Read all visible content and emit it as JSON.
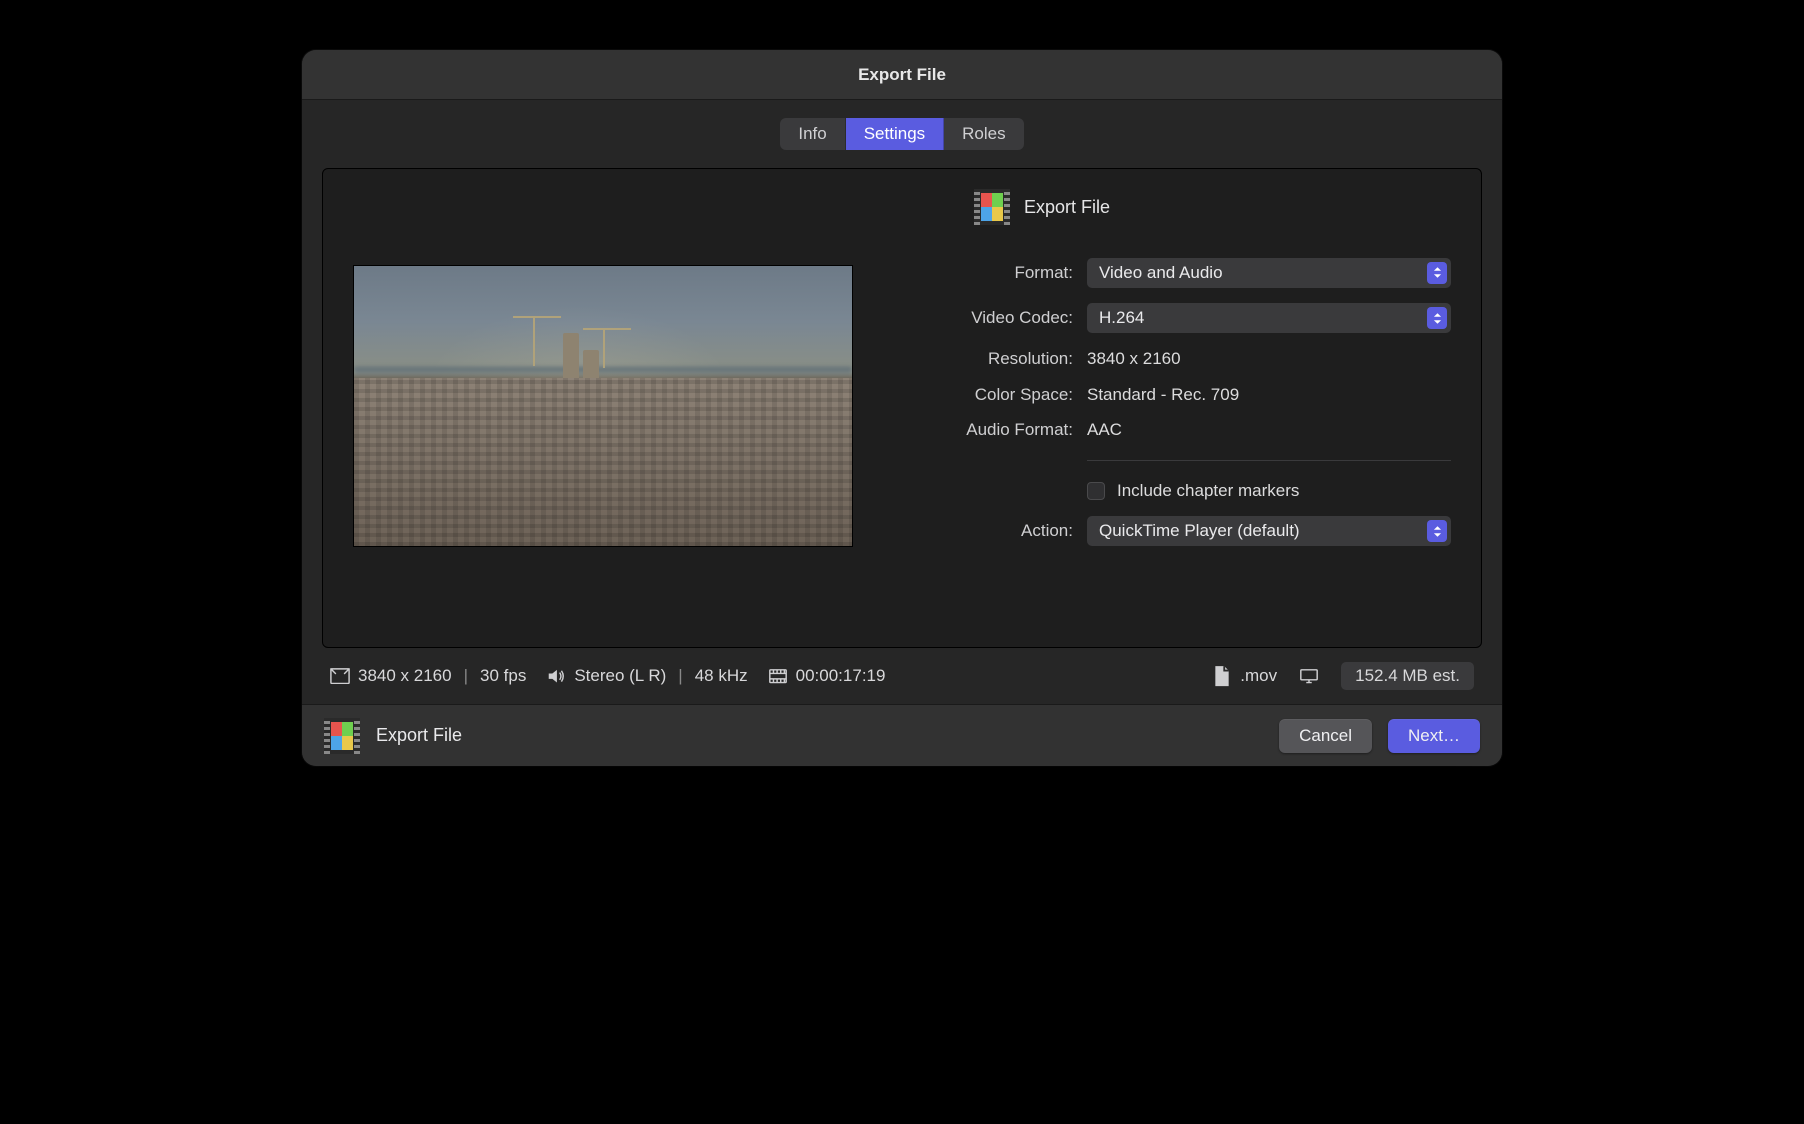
{
  "dialog": {
    "title": "Export File"
  },
  "tabs": {
    "info": "Info",
    "settings": "Settings",
    "roles": "Roles",
    "active": "settings"
  },
  "panel": {
    "title": "Export File"
  },
  "form": {
    "format_label": "Format:",
    "format_value": "Video and Audio",
    "codec_label": "Video Codec:",
    "codec_value": "H.264",
    "resolution_label": "Resolution:",
    "resolution_value": "3840 x 2160",
    "colorspace_label": "Color Space:",
    "colorspace_value": "Standard - Rec. 709",
    "audio_label": "Audio Format:",
    "audio_value": "AAC",
    "chapter_label": "Include chapter markers",
    "action_label": "Action:",
    "action_value": "QuickTime Player (default)"
  },
  "infobar": {
    "res": "3840 x 2160",
    "fps": "30 fps",
    "audio": "Stereo (L R)",
    "khz": "48 kHz",
    "duration": "00:00:17:19",
    "ext": ".mov",
    "size": "152.4 MB est."
  },
  "footer": {
    "title": "Export File",
    "cancel": "Cancel",
    "next": "Next…"
  }
}
